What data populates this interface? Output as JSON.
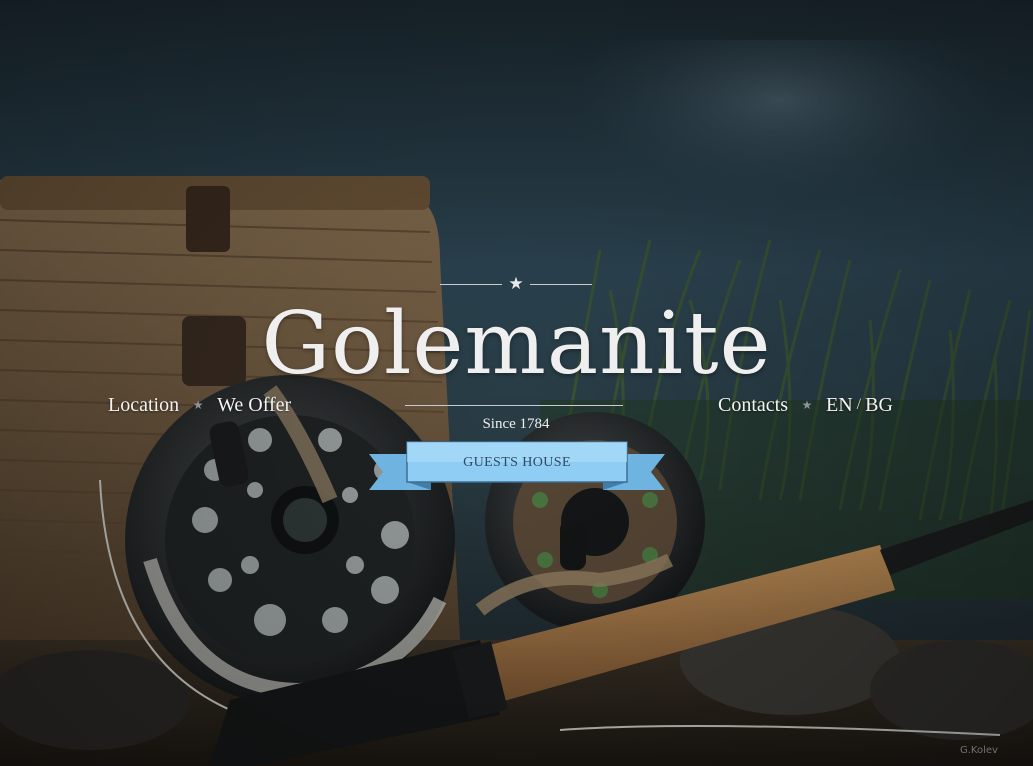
{
  "brand": {
    "name": "Golemanite",
    "since": "Since 1784",
    "ribbon_label": "GUESTS HOUSE"
  },
  "nav": {
    "left": [
      {
        "label": "Location"
      },
      {
        "label": "We Offer"
      }
    ],
    "right": [
      {
        "label": "Contacts"
      }
    ],
    "lang": {
      "en": "EN",
      "separator": "/",
      "bg": "BG"
    }
  },
  "credit": "G.Kolev",
  "icons": {
    "divider_star": "star-icon",
    "nav_separator": "star-icon"
  },
  "colors": {
    "title": "#efefef",
    "ribbon_fill": "#8fcdf5",
    "ribbon_text": "#2c4a60",
    "nav_text": "#f3f3f3"
  }
}
